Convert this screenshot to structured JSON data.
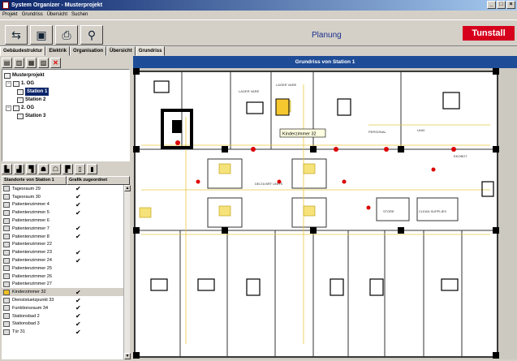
{
  "window": {
    "title": "System Organizer - Musterprojekt"
  },
  "menu": [
    "Projekt",
    "Grundriss",
    "Übersicht",
    "Suchen"
  ],
  "toolbar": {
    "title": "Planung",
    "logo": "Tunstall"
  },
  "tabs": [
    "Gebäudestruktur",
    "Elektrik",
    "Organisation",
    "Übersicht",
    "Grundriss"
  ],
  "tree": {
    "root": "Musterprojekt",
    "floors": [
      {
        "label": "1. OG",
        "stations": [
          "Station 1",
          "Station 2"
        ]
      },
      {
        "label": "2. OG",
        "stations": [
          "Station 3"
        ]
      }
    ],
    "selected": "Station 1"
  },
  "list": {
    "col1": "Standorte von Station 1",
    "col2": "Grafik zugeordnet",
    "rows": [
      {
        "name": "Tagesraum 29",
        "assigned": "✔"
      },
      {
        "name": "Tagesraum 30",
        "assigned": "✔"
      },
      {
        "name": "Patientenzimmer 4",
        "assigned": "✔"
      },
      {
        "name": "Patientenzimmer 5",
        "assigned": "✔"
      },
      {
        "name": "Patientenzimmer 6",
        "assigned": ""
      },
      {
        "name": "Patientenzimmer 7",
        "assigned": "✔"
      },
      {
        "name": "Patientenzimmer 8",
        "assigned": "✔"
      },
      {
        "name": "Patientenzimmer 22",
        "assigned": ""
      },
      {
        "name": "Patientenzimmer 23",
        "assigned": "✔"
      },
      {
        "name": "Patientenzimmer 24",
        "assigned": "✔"
      },
      {
        "name": "Patientenzimmer 25",
        "assigned": ""
      },
      {
        "name": "Patientenzimmer 26",
        "assigned": ""
      },
      {
        "name": "Patientenzimmer 27",
        "assigned": ""
      },
      {
        "name": "Kinderzimmer 32",
        "assigned": "✔"
      },
      {
        "name": "Dienststuetzpunkt 33",
        "assigned": "✔"
      },
      {
        "name": "Funktionsraum 34",
        "assigned": "✔"
      },
      {
        "name": "Stationsbad 2",
        "assigned": "✔"
      },
      {
        "name": "Stationsbad 3",
        "assigned": "✔"
      },
      {
        "name": "Tür 31",
        "assigned": "✔"
      }
    ],
    "highlighted_index": 13
  },
  "plan": {
    "header": "Grundriss von Station 1",
    "tooltip": "Kinderzimmer 32",
    "room_labels": [
      "LAGER VARE",
      "LAGER VARE",
      "UNIV",
      "PERSONAL",
      "STORE",
      "CLEAN SUPPLIES",
      "EKOBOT",
      "DELTA BRT UNITS"
    ]
  }
}
